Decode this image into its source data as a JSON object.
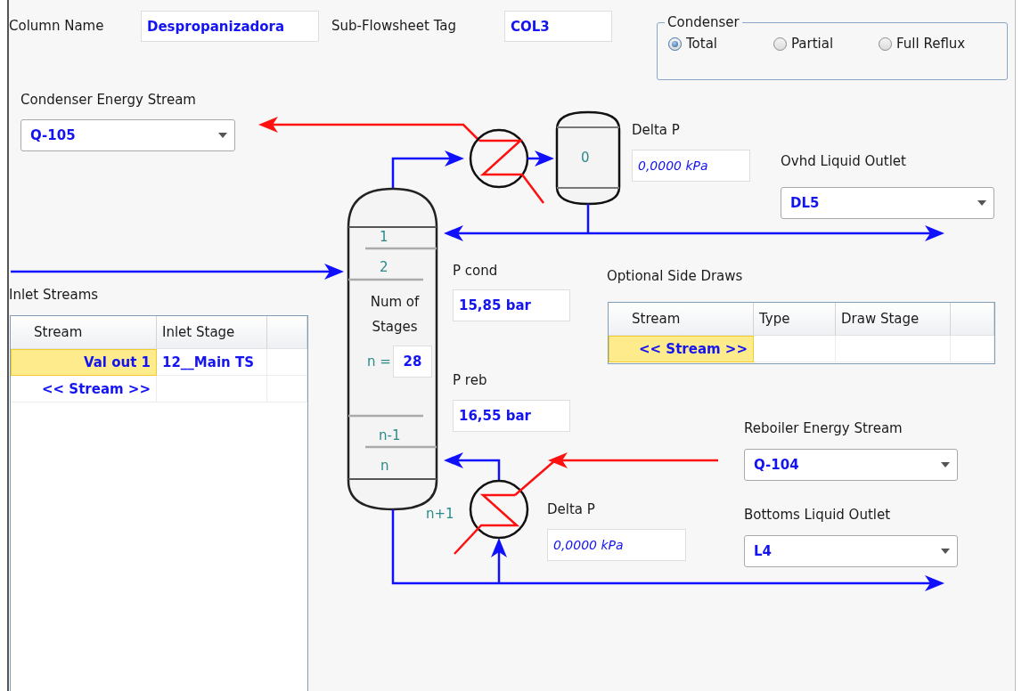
{
  "column_name": {
    "label": "Column Name",
    "value": "Despropanizadora"
  },
  "subflowsheet_tag": {
    "label": "Sub-Flowsheet Tag",
    "value": "COL3"
  },
  "condenser": {
    "title": "Condenser",
    "options": [
      {
        "label": "Total",
        "selected": true
      },
      {
        "label": "Partial",
        "selected": false
      },
      {
        "label": "Full Reflux",
        "selected": false
      }
    ]
  },
  "condenser_energy_stream": {
    "label": "Condenser Energy Stream",
    "value": "Q-105"
  },
  "condenser_vessel": {
    "label": "0"
  },
  "condenser_delta_p": {
    "label": "Delta P",
    "value": "0,0000 kPa"
  },
  "ovhd_liquid_outlet": {
    "label": "Ovhd Liquid Outlet",
    "value": "DL5"
  },
  "column": {
    "top_stages": [
      "1",
      "2"
    ],
    "stages_label": "Num of Stages",
    "n_label": "n =",
    "num_stages": "28",
    "bottom_stages": [
      "n-1",
      "n"
    ],
    "reboiler_stage": "n+1"
  },
  "p_cond": {
    "label": "P cond",
    "value": "15,85 bar"
  },
  "p_reb": {
    "label": "P reb",
    "value": "16,55 bar"
  },
  "inlet_streams": {
    "title": "Inlet Streams",
    "columns": [
      "Stream",
      "Inlet Stage"
    ],
    "rows": [
      {
        "cells": [
          "Val out 1",
          "12__Main TS"
        ],
        "selected": true
      },
      {
        "cells": [
          "<< Stream >>"
        ],
        "selected": false
      }
    ]
  },
  "side_draws": {
    "title": "Optional Side Draws",
    "columns": [
      "Stream",
      "Type",
      "Draw Stage"
    ],
    "rows": [
      {
        "cells": [
          "<< Stream >>"
        ],
        "selected": true
      }
    ]
  },
  "reboiler_energy_stream": {
    "label": "Reboiler Energy Stream",
    "value": "Q-104"
  },
  "reboiler_delta_p": {
    "label": "Delta P",
    "value": "0,0000 kPa"
  },
  "bottoms_liquid_outlet": {
    "label": "Bottoms Liquid Outlet",
    "value": "L4"
  }
}
